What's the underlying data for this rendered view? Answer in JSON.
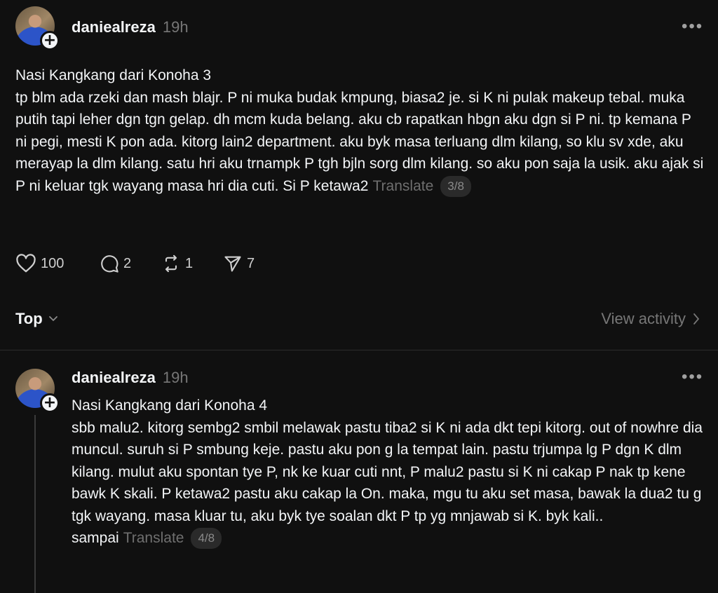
{
  "post1": {
    "username": "daniealreza",
    "time": "19h",
    "more": "•••",
    "text": "Nasi Kangkang dari Konoha 3\ntp blm ada rzeki dan mash blajr. P ni muka budak kmpung, biasa2 je. si K ni pulak makeup tebal. muka putih tapi leher dgn tgn gelap. dh mcm kuda belang. aku cb rapatkan hbgn aku dgn si P ni. tp kemana P ni pegi, mesti K pon ada. kitorg lain2 department. aku byk masa terluang dlm kilang, so klu sv xde, aku merayap la dlm kilang. satu hri aku trnampk P tgh bjln sorg dlm kilang. so aku pon saja la usik. aku ajak si P ni keluar tgk wayang masa hri dia cuti. Si P ketawa2",
    "translate": "Translate",
    "pager": "3/8",
    "actions": {
      "likes": "100",
      "comments": "2",
      "reposts": "1",
      "shares": "7"
    }
  },
  "sort": {
    "label": "Top",
    "view_activity": "View activity"
  },
  "post2": {
    "username": "daniealreza",
    "time": "19h",
    "more": "•••",
    "text": "Nasi Kangkang dari Konoha 4\nsbb malu2. kitorg sembg2 smbil melawak pastu tiba2 si K ni ada dkt tepi kitorg. out of nowhre dia muncul. suruh si P smbung keje. pastu aku pon g la tempat lain. pastu trjumpa lg P dgn K dlm kilang. mulut aku spontan tye P, nk ke kuar cuti nnt, P malu2 pastu si K ni cakap P nak tp kene bawk K skali. P ketawa2 pastu aku cakap la On. maka, mgu tu aku set masa, bawak la dua2 tu g tgk wayang. masa kluar tu, aku byk tye soalan dkt P tp yg mnjawab si K. byk kali.. sampai",
    "translate": "Translate",
    "pager": "4/8"
  }
}
